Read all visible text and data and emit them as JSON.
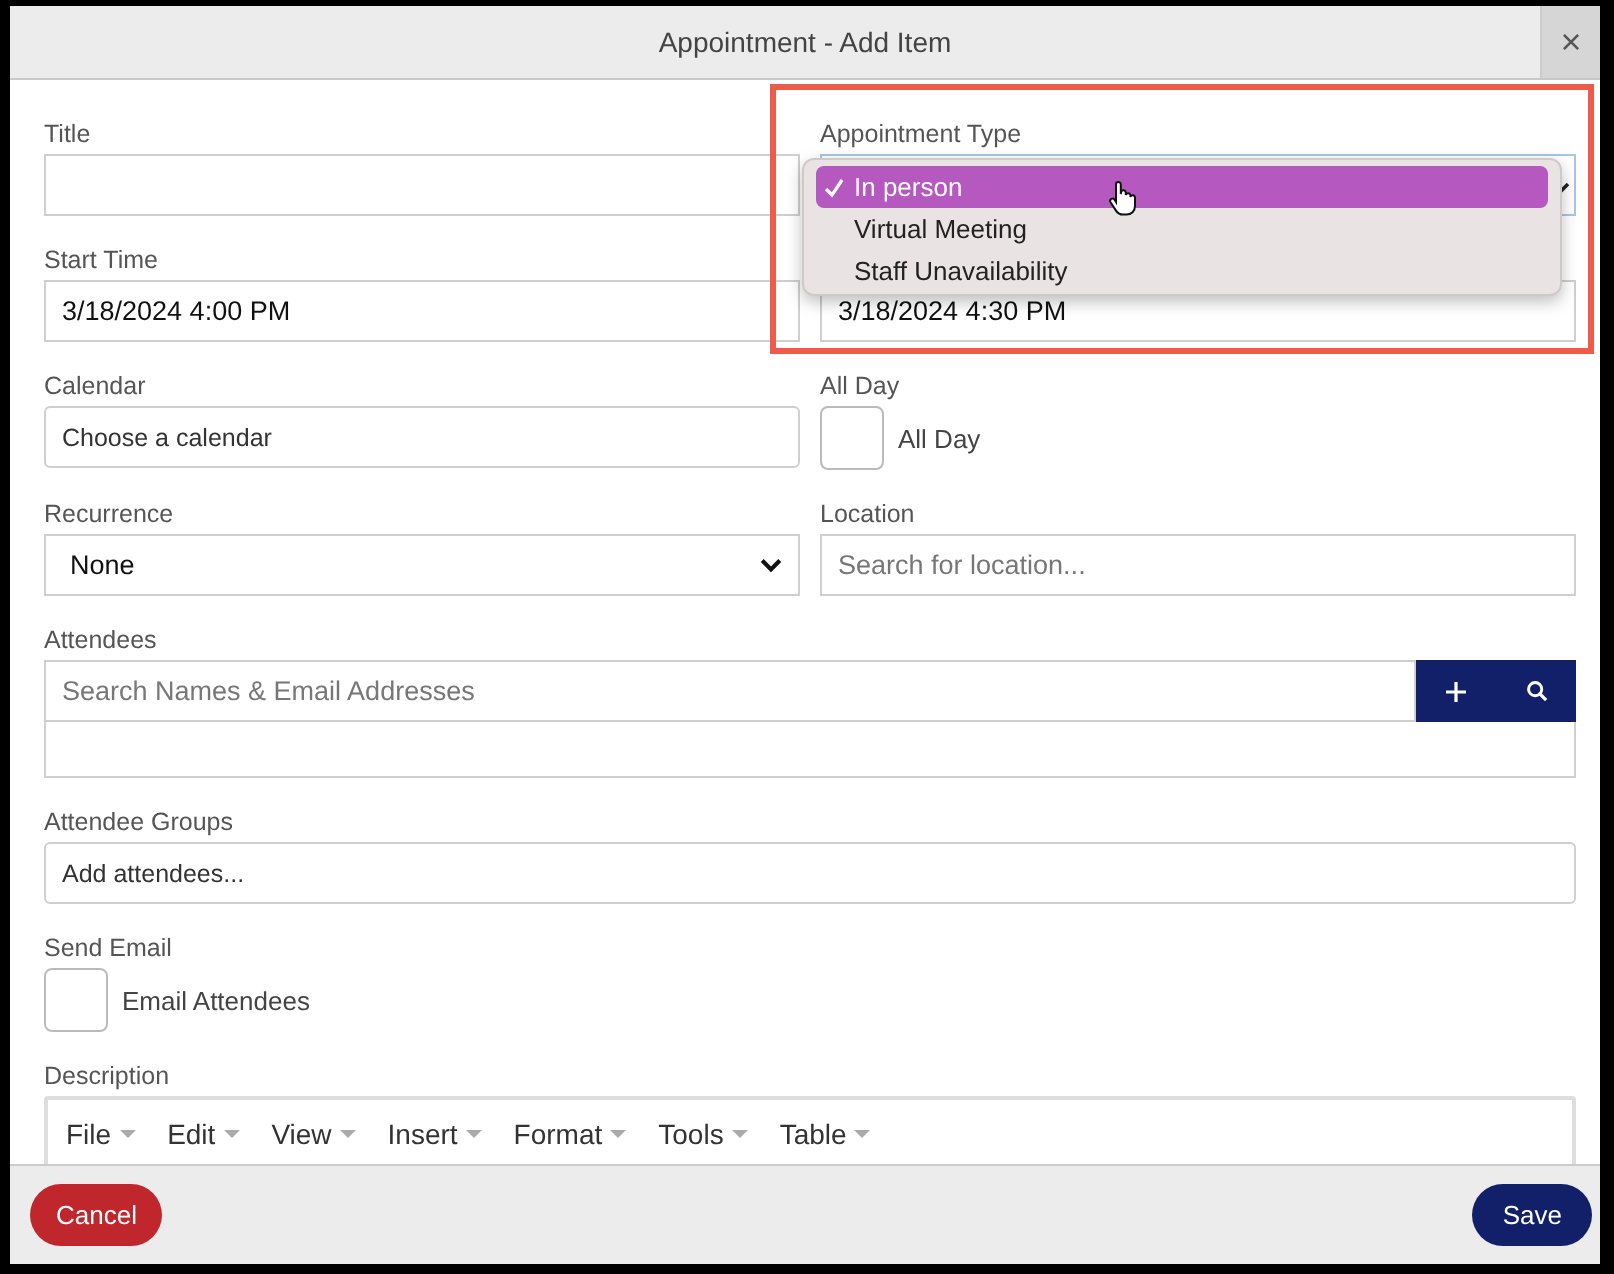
{
  "dialog": {
    "title": "Appointment - Add Item",
    "close": "×"
  },
  "title_field": {
    "label": "Title"
  },
  "appointment_type": {
    "label": "Appointment Type",
    "expanded": true,
    "options": [
      {
        "label": "In person",
        "selected": true
      },
      {
        "label": "Virtual Meeting",
        "selected": false
      },
      {
        "label": "Staff Unavailability",
        "selected": false
      }
    ]
  },
  "start_time": {
    "label": "Start Time",
    "value": "3/18/2024 4:00 PM"
  },
  "end_time": {
    "value": "3/18/2024 4:30 PM"
  },
  "calendar": {
    "label": "Calendar",
    "placeholder": "Choose a calendar"
  },
  "all_day": {
    "label": "All Day",
    "checkbox_label": "All Day",
    "checked": false
  },
  "recurrence": {
    "label": "Recurrence",
    "value": "None"
  },
  "location": {
    "label": "Location",
    "placeholder": "Search for location..."
  },
  "attendees": {
    "label": "Attendees",
    "placeholder": "Search Names & Email Addresses"
  },
  "attendee_groups": {
    "label": "Attendee Groups",
    "placeholder": "Add attendees..."
  },
  "send_email": {
    "label": "Send Email",
    "checkbox_label": "Email Attendees",
    "checked": false
  },
  "description": {
    "label": "Description",
    "menu": [
      "File",
      "Edit",
      "View",
      "Insert",
      "Format",
      "Tools",
      "Table"
    ]
  },
  "footer": {
    "buttons": [
      {
        "label": "Cancel",
        "kind": "cancel"
      },
      {
        "label": "Save",
        "kind": "primary"
      }
    ]
  }
}
